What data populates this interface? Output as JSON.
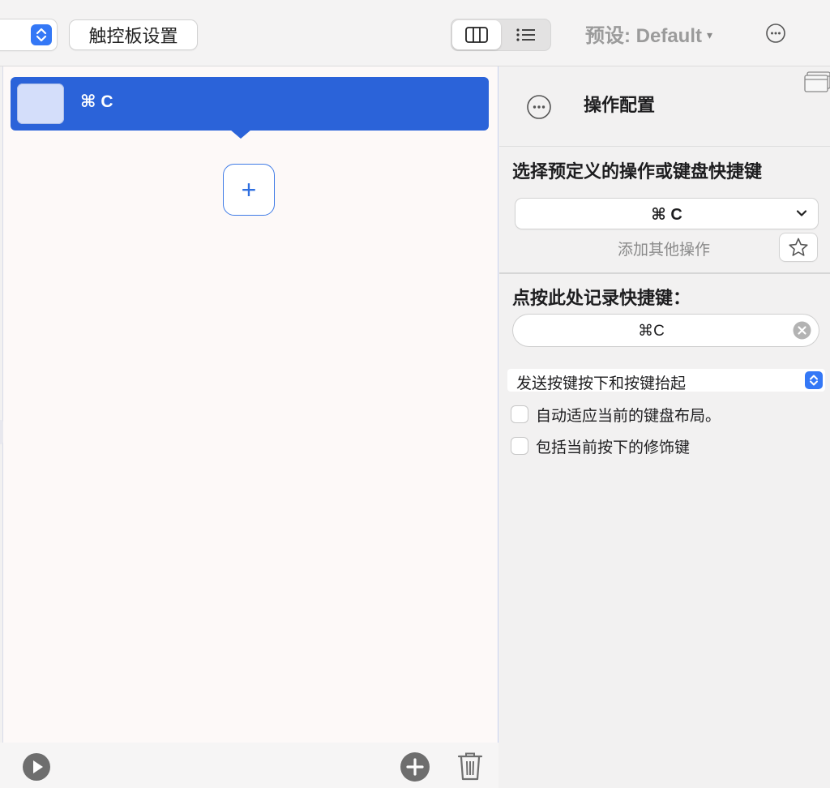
{
  "toolbar": {
    "touchpad_settings_label": "触控板设置",
    "preset_label": "预设: Default",
    "preset_caret": "▾"
  },
  "action_list": {
    "items": [
      {
        "label": "⌘ C"
      }
    ],
    "add_symbol": "+"
  },
  "config": {
    "title": "操作配置",
    "choose_label": "选择预定义的操作或键盘快捷键",
    "selected_action": "⌘ C",
    "add_other_label": "添加其他操作",
    "record_label": "点按此处记录快捷键：",
    "recorded_shortcut": "⌘C",
    "send_mode": "发送按键按下和按键抬起",
    "checkbox_adapt_layout": "自动适应当前的键盘布局。",
    "checkbox_include_modifiers": "包括当前按下的修饰键"
  },
  "colors": {
    "accent": "#2b63d9",
    "stepper_blue": "#3478f6"
  },
  "icons": {
    "view_columns": "columns-icon",
    "view_list": "list-icon",
    "more": "ellipsis-circle-icon",
    "window": "window-icon",
    "play": "play-circle-icon",
    "add": "plus-circle-icon",
    "trash": "trash-icon",
    "star": "star-icon",
    "clear": "xmark-circle-icon",
    "chevron": "chevron-down-icon"
  }
}
